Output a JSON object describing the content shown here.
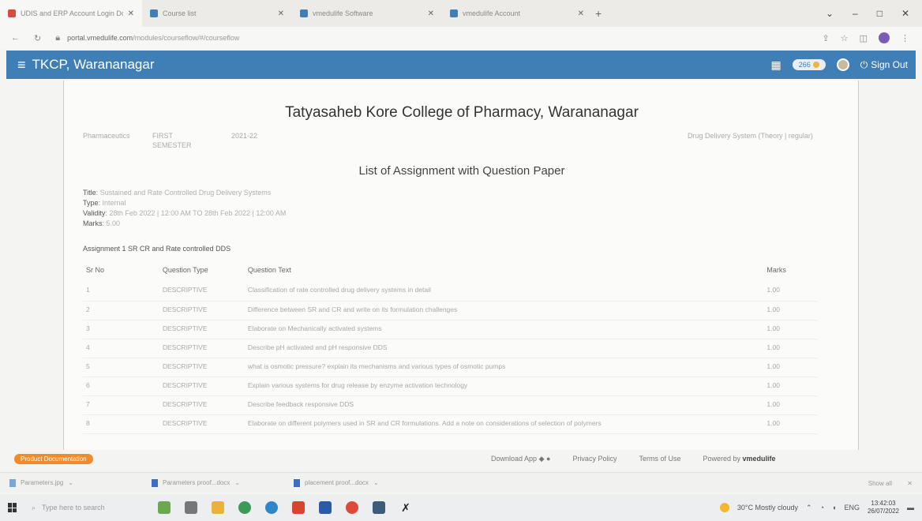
{
  "browser": {
    "tabs": [
      {
        "title": "UDIS and ERP Account Login Do",
        "favicon_color": "#d94b3a"
      },
      {
        "title": "Course list",
        "favicon_color": "#3f7fb6"
      },
      {
        "title": "vmedulife Software",
        "favicon_color": "#3f7fb6"
      },
      {
        "title": "vmedulife Account",
        "favicon_color": "#3f7fb6"
      }
    ],
    "new_tab": "+",
    "url_host": "portal.vmedulife.com",
    "url_path": "/modules/courseflow/#/courseflow"
  },
  "app": {
    "title": "TKCP, Warananagar",
    "points": "266",
    "sign_out": "Sign Out",
    "accent": "#3f7fb6"
  },
  "page": {
    "college": "Tatyasaheb Kore College of Pharmacy, Warananagar",
    "program": "Pharmaceutics",
    "semester": "FIRST SEMESTER",
    "year": "2021-22",
    "subject": "Drug Delivery System (Theory | regular)",
    "list_title": "List of Assignment with Question Paper",
    "info": {
      "title_label": "Title",
      "title_value": "Sustained and Rate Controlled Drug Delivery Systems",
      "type_label": "Type",
      "type_value": "Internal",
      "validity_label": "Validity",
      "validity_value": "28th Feb 2022 | 12:00 AM TO 28th Feb 2022 | 12:00 AM",
      "marks_label": "Marks",
      "marks_value": "5.00"
    },
    "assignment": "Assignment 1 SR CR and Rate controlled DDS",
    "table": {
      "headers": [
        "Sr No",
        "Question Type",
        "Question Text",
        "Marks"
      ],
      "rows": [
        [
          "1",
          "DESCRIPTIVE",
          "Classification of rate controlled drug delivery systems in detail",
          "1.00"
        ],
        [
          "2",
          "DESCRIPTIVE",
          "Difference between SR and CR and write on its formulation challenges",
          "1.00"
        ],
        [
          "3",
          "DESCRIPTIVE",
          "Elaborate on Mechanically activated systems",
          "1.00"
        ],
        [
          "4",
          "DESCRIPTIVE",
          "Describe pH activated and pH responsive DDS",
          "1.00"
        ],
        [
          "5",
          "DESCRIPTIVE",
          "what is osmotic pressure? explain its mechanisms and various types of osmotic pumps",
          "1.00"
        ],
        [
          "6",
          "DESCRIPTIVE",
          "Explain various systems for drug release by enzyme activation technology",
          "1.00"
        ],
        [
          "7",
          "DESCRIPTIVE",
          "Describe feedback responsive DDS",
          "1.00"
        ],
        [
          "8",
          "DESCRIPTIVE",
          "Elaborate on different polymers used in SR and CR formulations. Add a note on considerations of selection of polymers",
          "1.00"
        ]
      ]
    }
  },
  "footer": {
    "doc_button": "Product Documentation",
    "download_app": "Download App",
    "privacy": "Privacy Policy",
    "terms": "Terms of Use",
    "powered_prefix": "Powered by",
    "powered_brand": "vmedulife"
  },
  "downloads": {
    "items": [
      "Parameters.jpg",
      "Parameters proof...docx",
      "placement proof...docx"
    ],
    "show_all": "Show all"
  },
  "taskbar": {
    "search_placeholder": "Type here to search",
    "weather": "30°C Mostly cloudy",
    "lang": "ENG",
    "time": "13:42:03",
    "date": "26/07/2022"
  }
}
